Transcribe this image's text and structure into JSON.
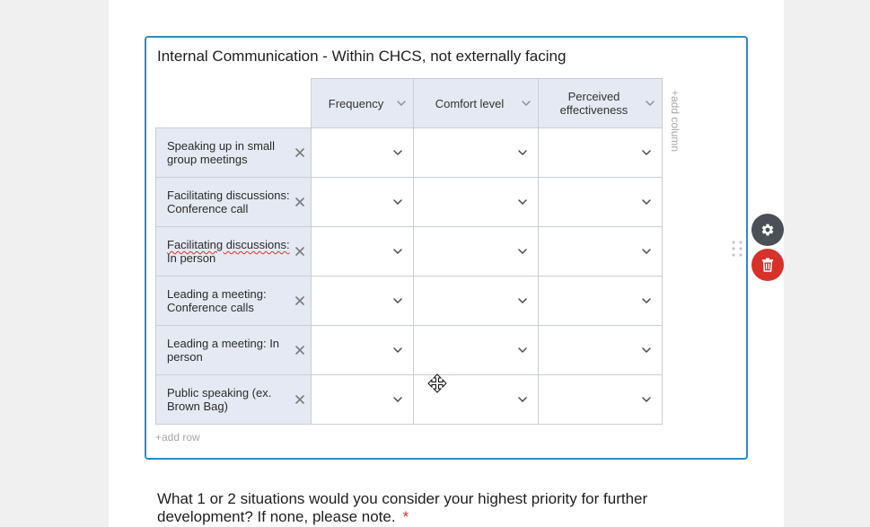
{
  "colors": {
    "page_background": "#f0f0f0",
    "panel_background": "#ffffff",
    "accent": "#2a8cc4",
    "header_fill": "#e5e9f3",
    "grid_line": "#c8ced8",
    "settings_button": "#4b5057",
    "delete_button": "#d6312a",
    "required": "#e0312b"
  },
  "icons": {
    "column_menu": "chevron-down-icon",
    "cell_dropdown": "chevron-down-icon",
    "remove_row": "close-icon",
    "drag_handle": "drag-handle-icon",
    "settings": "gear-icon",
    "delete": "trash-icon",
    "cursor": "move-cursor-icon"
  },
  "question": {
    "title": "Internal Communication - Within CHCS, not externally facing",
    "columns": [
      {
        "label": "Frequency"
      },
      {
        "label": "Comfort level"
      },
      {
        "label": "Perceived effectiveness"
      }
    ],
    "rows": [
      {
        "label": "Speaking up in small group meetings"
      },
      {
        "label": "Facilitating discussions: Conference call"
      },
      {
        "label": "Facilitating discussions: In person"
      },
      {
        "label": "Leading a meeting: Conference calls"
      },
      {
        "label": "Leading a meeting: In person"
      },
      {
        "label": "Public speaking (ex. Brown Bag)"
      }
    ],
    "add_column_label": "+add column",
    "add_row_label": "+add row"
  },
  "next_question": {
    "text": "What 1 or 2 situations would you consider your highest priority for further development? If none, please note.",
    "required_mark": "*"
  }
}
